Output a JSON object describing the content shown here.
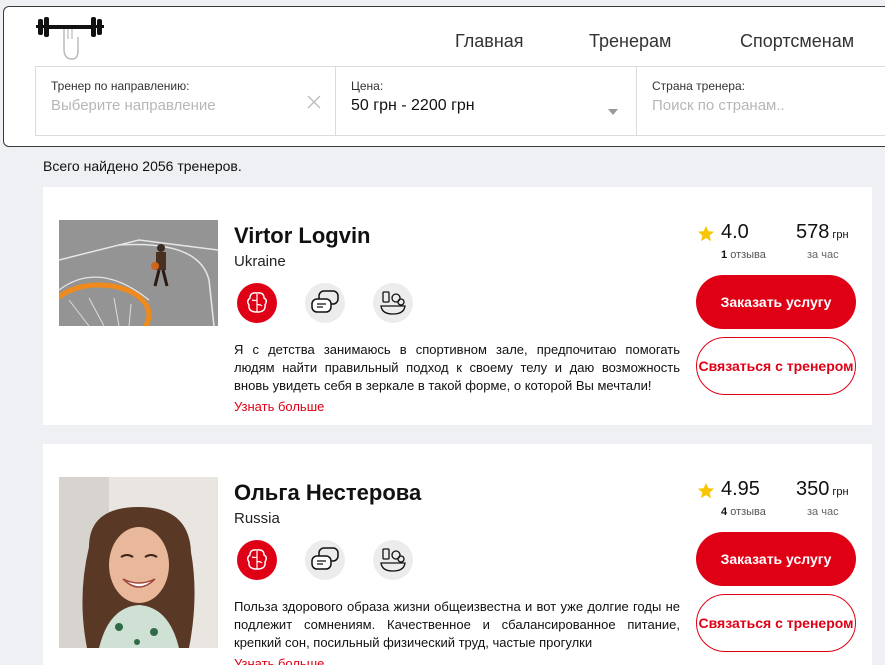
{
  "nav": {
    "logo_icon": "barbell-icon",
    "home": "Главная",
    "trainers": "Тренерам",
    "athletes": "Спортсменам"
  },
  "filters": {
    "direction": {
      "label": "Тренер по направлению:",
      "placeholder": "Выберите направление"
    },
    "price": {
      "label": "Цена:",
      "value": "50 грн - 2200 грн"
    },
    "country": {
      "label": "Страна тренера:",
      "placeholder": "Поиск по странам.."
    }
  },
  "results_text": "Всего найдено 2056 тренеров.",
  "accent_color": "#e00016",
  "trainers": [
    {
      "name": "Virtor Logvin",
      "country": "Ukraine",
      "rating": "4.0",
      "reviews_count": "1",
      "reviews_label": "отзыва",
      "price": "578",
      "currency": "грн",
      "per_hour": "за час",
      "description": "Я с детства занимаюсь в спортивном зале, предпочитаю помогать людям найти правильный подход к своему телу и даю возможность вновь увидеть себя в зеркале в такой форме, о которой Вы мечтали!",
      "more": "Узнать больше",
      "order_button": "Заказать услугу",
      "contact_button": "Связаться с тренером",
      "service_icons": [
        "brain-icon",
        "chat-icon",
        "healthy-food-icon"
      ]
    },
    {
      "name": "Ольга Нестерова",
      "country": "Russia",
      "rating": "4.95",
      "reviews_count": "4",
      "reviews_label": "отзыва",
      "price": "350",
      "currency": "грн",
      "per_hour": "за час",
      "description": "Польза здорового образа жизни общеизвестна и вот уже долгие годы не подлежит сомнениям. Качественное и сбалансированное питание, крепкий сон, посильный физический труд, частые прогулки",
      "more": "Узнать больше",
      "order_button": "Заказать услугу",
      "contact_button": "Связаться с тренером",
      "service_icons": [
        "brain-icon",
        "chat-icon",
        "healthy-food-icon"
      ]
    }
  ]
}
